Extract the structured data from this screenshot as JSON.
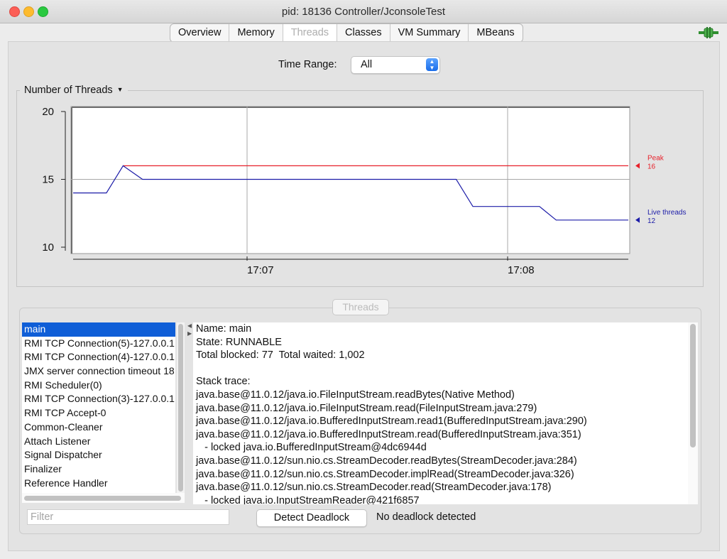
{
  "window": {
    "title": "pid: 18136 Controller/JconsoleTest"
  },
  "tabs": [
    "Overview",
    "Memory",
    "Threads",
    "Classes",
    "VM Summary",
    "MBeans"
  ],
  "active_tab": "Threads",
  "time_range": {
    "label": "Time Range:",
    "value": "All"
  },
  "chart_panel": {
    "title": "Number of Threads"
  },
  "chart_data": {
    "type": "line",
    "title": "Number of Threads",
    "ylim": [
      10,
      20
    ],
    "yticks": [
      "10",
      "15",
      "20"
    ],
    "xticks": [
      "17:07",
      "17:08"
    ],
    "series": [
      {
        "name": "Peak",
        "current": "16",
        "color": "#e8202a",
        "points": [
          [
            0.09,
            16
          ],
          [
            1.0,
            16
          ]
        ]
      },
      {
        "name": "Live threads",
        "current": "12",
        "color": "#1c1ca8",
        "points": [
          [
            0.0,
            14
          ],
          [
            0.06,
            14
          ],
          [
            0.09,
            16
          ],
          [
            0.125,
            15
          ],
          [
            0.69,
            15
          ],
          [
            0.72,
            13
          ],
          [
            0.84,
            13
          ],
          [
            0.87,
            12
          ],
          [
            1.0,
            12
          ]
        ]
      }
    ]
  },
  "threads_section": {
    "label": "Threads"
  },
  "thread_list": [
    "main",
    "RMI TCP Connection(5)-127.0.0.1",
    "RMI TCP Connection(4)-127.0.0.1",
    "JMX server connection timeout 18",
    "RMI Scheduler(0)",
    "RMI TCP Connection(3)-127.0.0.1",
    "RMI TCP Accept-0",
    "Common-Cleaner",
    "Attach Listener",
    "Signal Dispatcher",
    "Finalizer",
    "Reference Handler"
  ],
  "selected_thread": "main",
  "thread_detail": [
    "Name: main",
    "State: RUNNABLE",
    "Total blocked: 77  Total waited: 1,002",
    "",
    "Stack trace:",
    "java.base@11.0.12/java.io.FileInputStream.readBytes(Native Method)",
    "java.base@11.0.12/java.io.FileInputStream.read(FileInputStream.java:279)",
    "java.base@11.0.12/java.io.BufferedInputStream.read1(BufferedInputStream.java:290)",
    "java.base@11.0.12/java.io.BufferedInputStream.read(BufferedInputStream.java:351)",
    "   - locked java.io.BufferedInputStream@4dc6944d",
    "java.base@11.0.12/sun.nio.cs.StreamDecoder.readBytes(StreamDecoder.java:284)",
    "java.base@11.0.12/sun.nio.cs.StreamDecoder.implRead(StreamDecoder.java:326)",
    "java.base@11.0.12/sun.nio.cs.StreamDecoder.read(StreamDecoder.java:178)",
    "   - locked java.io.InputStreamReader@421f6857"
  ],
  "filter": {
    "placeholder": "Filter",
    "value": ""
  },
  "detect_button": "Detect Deadlock",
  "deadlock_status": "No deadlock detected",
  "icons": {
    "connection": "connection-plug-icon"
  }
}
